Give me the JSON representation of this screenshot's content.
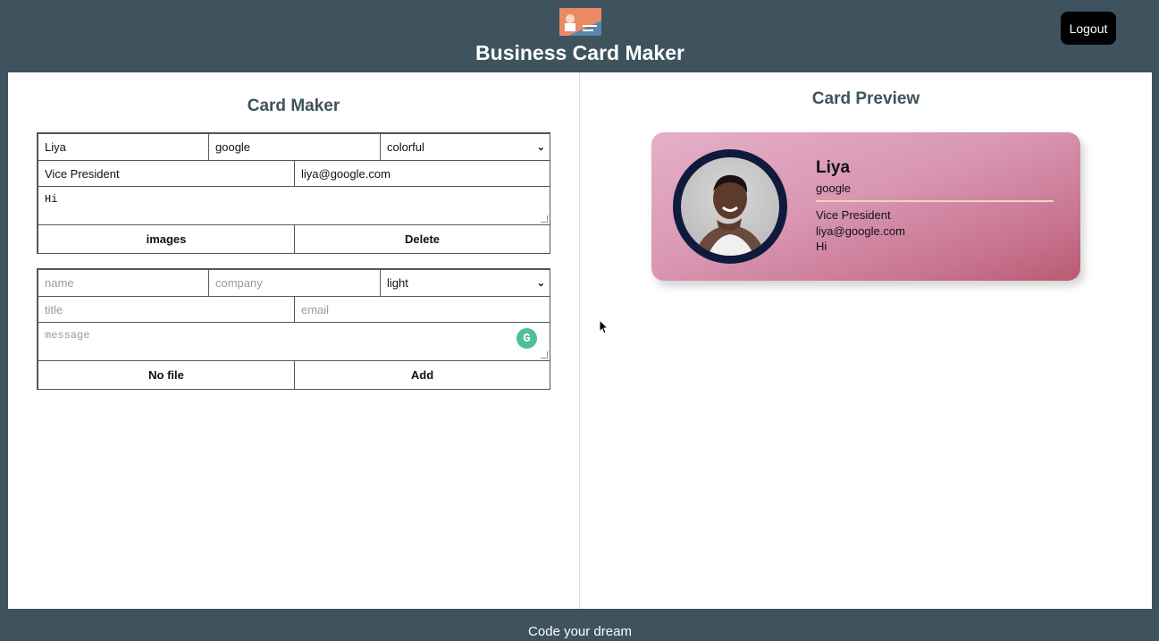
{
  "header": {
    "title": "Business Card Maker",
    "logout_label": "Logout",
    "logo_icon": "business-card-logo-icon"
  },
  "maker": {
    "title": "Card Maker",
    "card_form": {
      "name": "Liya",
      "company": "google",
      "theme": "colorful",
      "title": "Vice President",
      "email": "liya@google.com",
      "message": "Hi",
      "file_button": "images",
      "action_button": "Delete"
    },
    "add_form": {
      "name_placeholder": "name",
      "company_placeholder": "company",
      "theme": "light",
      "title_placeholder": "title",
      "email_placeholder": "email",
      "message_placeholder": "message",
      "file_button": "No file",
      "action_button": "Add"
    }
  },
  "preview": {
    "title": "Card Preview",
    "card": {
      "name": "Liya",
      "company": "google",
      "title": "Vice President",
      "email": "liya@google.com",
      "message": "Hi",
      "theme_colors": [
        "#e6afc8",
        "#b85a72"
      ]
    }
  },
  "footer": {
    "text": "Code your dream"
  },
  "colors": {
    "brand_dark": "#3e535d",
    "images_button_bg": "#fde8e9",
    "grammarly": "#4fbf94"
  }
}
